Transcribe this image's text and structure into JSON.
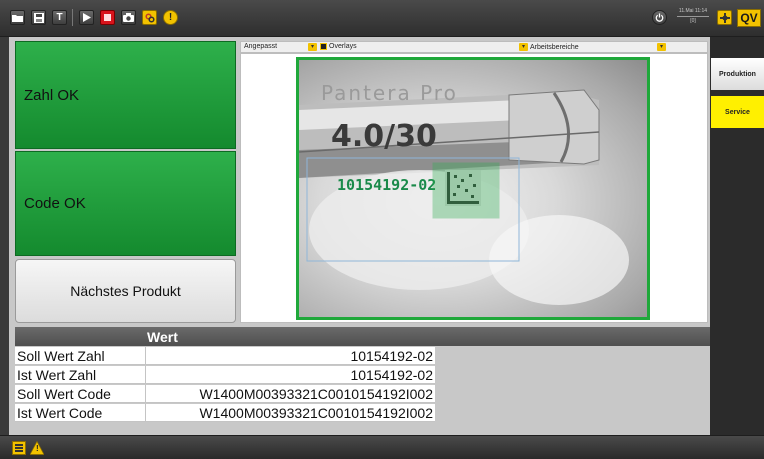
{
  "toolbar": {
    "buttons": [
      "open-icon",
      "save-icon",
      "text-icon",
      "play-icon",
      "stop-icon",
      "camera-icon",
      "link-icon",
      "info-icon"
    ],
    "text_button_label": "T",
    "info_label": "!",
    "power_icon": "power-icon",
    "clock_line1": "11.Mai  11:14",
    "clock_line2": "[0]",
    "brand": "QV"
  },
  "sidebar": {
    "tabs": [
      {
        "label": "Produktion",
        "active": true
      },
      {
        "label": "Service",
        "active": false
      }
    ]
  },
  "status": {
    "zahl": "Zahl OK",
    "code": "Code OK",
    "color": "#1f9e3d"
  },
  "next_button": "Nächstes Produkt",
  "image_header": {
    "fit": "Angepasst",
    "overlays": "Overlays",
    "areas": "Arbeitsbereiche"
  },
  "camera": {
    "brand_text": "Pantera Pro",
    "size_text": "4.0/30",
    "ocr_text": "10154192-02",
    "frame_color": "#1fa83a"
  },
  "table": {
    "header": "Wert",
    "rows": [
      {
        "label": "Soll Wert Zahl",
        "value": "10154192-02"
      },
      {
        "label": "Ist Wert Zahl",
        "value": "10154192-02"
      },
      {
        "label": "Soll Wert Code",
        "value": "W1400M00393321C0010154192I002"
      },
      {
        "label": "Ist Wert Code",
        "value": "W1400M00393321C0010154192I002"
      }
    ]
  },
  "bottombar": {
    "warning_label": "!"
  }
}
